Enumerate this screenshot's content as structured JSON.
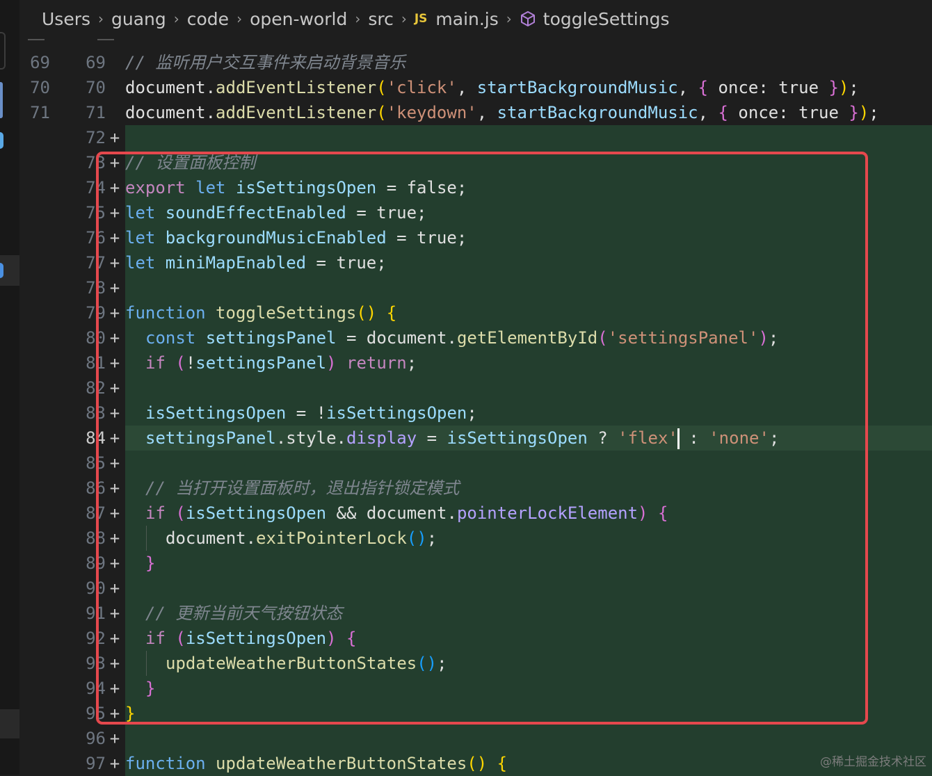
{
  "breadcrumb": {
    "parts": [
      "Users",
      "guang",
      "code",
      "open-world",
      "src"
    ],
    "file": "main.js",
    "file_badge": "JS",
    "symbol": "toggleSettings",
    "separator": "›"
  },
  "editor": {
    "added_marker": "+",
    "cursor_line": 84,
    "lines": [
      {
        "old": "69",
        "new": "69",
        "added": false,
        "indent": 0,
        "tokens": [
          [
            "// 监听用户交互事件来启动背景音乐",
            "c"
          ]
        ]
      },
      {
        "old": "70",
        "new": "70",
        "added": false,
        "indent": 0,
        "tokens": [
          [
            "document.",
            ""
          ],
          [
            "addEventListener",
            "f"
          ],
          [
            "(",
            "y"
          ],
          [
            "'click'",
            "s"
          ],
          [
            ", ",
            ""
          ],
          [
            "startBackgroundMusic",
            "v"
          ],
          [
            ", ",
            ""
          ],
          [
            "{",
            "m"
          ],
          [
            " once: true ",
            ""
          ],
          [
            "}",
            "m"
          ],
          [
            ")",
            "y"
          ],
          [
            ";",
            ""
          ]
        ]
      },
      {
        "old": "71",
        "new": "71",
        "added": false,
        "indent": 0,
        "tokens": [
          [
            "document.",
            ""
          ],
          [
            "addEventListener",
            "f"
          ],
          [
            "(",
            "y"
          ],
          [
            "'keydown'",
            "s"
          ],
          [
            ", ",
            ""
          ],
          [
            "startBackgroundMusic",
            "v"
          ],
          [
            ", ",
            ""
          ],
          [
            "{",
            "m"
          ],
          [
            " once: true ",
            ""
          ],
          [
            "}",
            "m"
          ],
          [
            ")",
            "y"
          ],
          [
            ";",
            ""
          ]
        ]
      },
      {
        "old": "",
        "new": "72",
        "added": true,
        "indent": 0,
        "tokens": []
      },
      {
        "old": "",
        "new": "73",
        "added": true,
        "indent": 0,
        "tokens": [
          [
            "// 设置面板控制",
            "c"
          ]
        ]
      },
      {
        "old": "",
        "new": "74",
        "added": true,
        "indent": 0,
        "tokens": [
          [
            "export ",
            "kc"
          ],
          [
            "let ",
            "k"
          ],
          [
            "isSettingsOpen",
            "v"
          ],
          [
            " = false;",
            ""
          ]
        ]
      },
      {
        "old": "",
        "new": "75",
        "added": true,
        "indent": 0,
        "tokens": [
          [
            "let ",
            "k"
          ],
          [
            "soundEffectEnabled",
            "v"
          ],
          [
            " = true;",
            ""
          ]
        ]
      },
      {
        "old": "",
        "new": "76",
        "added": true,
        "indent": 0,
        "tokens": [
          [
            "let ",
            "k"
          ],
          [
            "backgroundMusicEnabled",
            "v"
          ],
          [
            " = true;",
            ""
          ]
        ]
      },
      {
        "old": "",
        "new": "77",
        "added": true,
        "indent": 0,
        "tokens": [
          [
            "let ",
            "k"
          ],
          [
            "miniMapEnabled",
            "v"
          ],
          [
            " = true;",
            ""
          ]
        ]
      },
      {
        "old": "",
        "new": "78",
        "added": true,
        "indent": 0,
        "tokens": []
      },
      {
        "old": "",
        "new": "79",
        "added": true,
        "indent": 0,
        "tokens": [
          [
            "function ",
            "k"
          ],
          [
            "toggleSettings",
            "f"
          ],
          [
            "()",
            "y"
          ],
          [
            " ",
            ""
          ],
          [
            "{",
            "y"
          ]
        ]
      },
      {
        "old": "",
        "new": "80",
        "added": true,
        "indent": 1,
        "tokens": [
          [
            "const ",
            "k"
          ],
          [
            "settingsPanel",
            "v"
          ],
          [
            " = document.",
            ""
          ],
          [
            "getElementById",
            "f"
          ],
          [
            "(",
            "m"
          ],
          [
            "'settingsPanel'",
            "s"
          ],
          [
            ")",
            "m"
          ],
          [
            ";",
            ""
          ]
        ]
      },
      {
        "old": "",
        "new": "81",
        "added": true,
        "indent": 1,
        "tokens": [
          [
            "if ",
            "kc"
          ],
          [
            "(",
            "m"
          ],
          [
            "!",
            ""
          ],
          [
            "settingsPanel",
            "v"
          ],
          [
            ")",
            "m"
          ],
          [
            " return",
            "kc"
          ],
          [
            ";",
            ""
          ]
        ]
      },
      {
        "old": "",
        "new": "82",
        "added": true,
        "indent": 0,
        "tokens": []
      },
      {
        "old": "",
        "new": "83",
        "added": true,
        "indent": 1,
        "tokens": [
          [
            "isSettingsOpen",
            "v"
          ],
          [
            " = !",
            ""
          ],
          [
            "isSettingsOpen",
            "v"
          ],
          [
            ";",
            ""
          ]
        ]
      },
      {
        "old": "",
        "new": "84",
        "added": true,
        "indent": 1,
        "tokens": [
          [
            "settingsPanel",
            "v"
          ],
          [
            ".style.",
            ""
          ],
          [
            "display",
            "p"
          ],
          [
            " = ",
            ""
          ],
          [
            "isSettingsOpen",
            "v"
          ],
          [
            " ? ",
            ""
          ],
          [
            "'flex'",
            "s"
          ],
          [
            "|",
            "cursor"
          ],
          [
            " : ",
            ""
          ],
          [
            "'none'",
            "s"
          ],
          [
            ";",
            ""
          ]
        ]
      },
      {
        "old": "",
        "new": "85",
        "added": true,
        "indent": 0,
        "tokens": []
      },
      {
        "old": "",
        "new": "86",
        "added": true,
        "indent": 1,
        "tokens": [
          [
            "// 当打开设置面板时，退出指针锁定模式",
            "c"
          ]
        ]
      },
      {
        "old": "",
        "new": "87",
        "added": true,
        "indent": 1,
        "tokens": [
          [
            "if ",
            "kc"
          ],
          [
            "(",
            "m"
          ],
          [
            "isSettingsOpen",
            "v"
          ],
          [
            " && document.",
            ""
          ],
          [
            "pointerLockElement",
            "p"
          ],
          [
            ")",
            "m"
          ],
          [
            " ",
            ""
          ],
          [
            "{",
            "m"
          ]
        ]
      },
      {
        "old": "",
        "new": "88",
        "added": true,
        "indent": 2,
        "tokens": [
          [
            "document.",
            ""
          ],
          [
            "exitPointerLock",
            "f"
          ],
          [
            "()",
            "b"
          ],
          [
            ";",
            ""
          ]
        ]
      },
      {
        "old": "",
        "new": "89",
        "added": true,
        "indent": 1,
        "tokens": [
          [
            "}",
            "m"
          ]
        ]
      },
      {
        "old": "",
        "new": "90",
        "added": true,
        "indent": 0,
        "tokens": []
      },
      {
        "old": "",
        "new": "91",
        "added": true,
        "indent": 1,
        "tokens": [
          [
            "// 更新当前天气按钮状态",
            "c"
          ]
        ]
      },
      {
        "old": "",
        "new": "92",
        "added": true,
        "indent": 1,
        "tokens": [
          [
            "if ",
            "kc"
          ],
          [
            "(",
            "m"
          ],
          [
            "isSettingsOpen",
            "v"
          ],
          [
            ")",
            "m"
          ],
          [
            " ",
            ""
          ],
          [
            "{",
            "m"
          ]
        ]
      },
      {
        "old": "",
        "new": "93",
        "added": true,
        "indent": 2,
        "tokens": [
          [
            "updateWeatherButtonStates",
            "f"
          ],
          [
            "()",
            "b"
          ],
          [
            ";",
            ""
          ]
        ]
      },
      {
        "old": "",
        "new": "94",
        "added": true,
        "indent": 1,
        "tokens": [
          [
            "}",
            "m"
          ]
        ]
      },
      {
        "old": "",
        "new": "95",
        "added": true,
        "indent": 0,
        "tokens": [
          [
            "}",
            "y"
          ]
        ]
      },
      {
        "old": "",
        "new": "96",
        "added": true,
        "indent": 0,
        "tokens": []
      },
      {
        "old": "",
        "new": "97",
        "added": true,
        "indent": 0,
        "tokens": [
          [
            "function ",
            "k"
          ],
          [
            "updateWeatherButtonStates",
            "f"
          ],
          [
            "()",
            "y"
          ],
          [
            " ",
            ""
          ],
          [
            "{",
            "y"
          ]
        ]
      }
    ]
  },
  "watermark": "@稀土掘金技术社区",
  "colors": {
    "background": "#1e1e1e",
    "added_line_bg": "#233e2e",
    "highlight_box": "#e5484d",
    "keyword": "#6cb0f0",
    "control_keyword": "#c586c0",
    "function": "#dcdcaa",
    "variable": "#9cdcfe",
    "string": "#ce9178",
    "comment": "#7f868f"
  }
}
